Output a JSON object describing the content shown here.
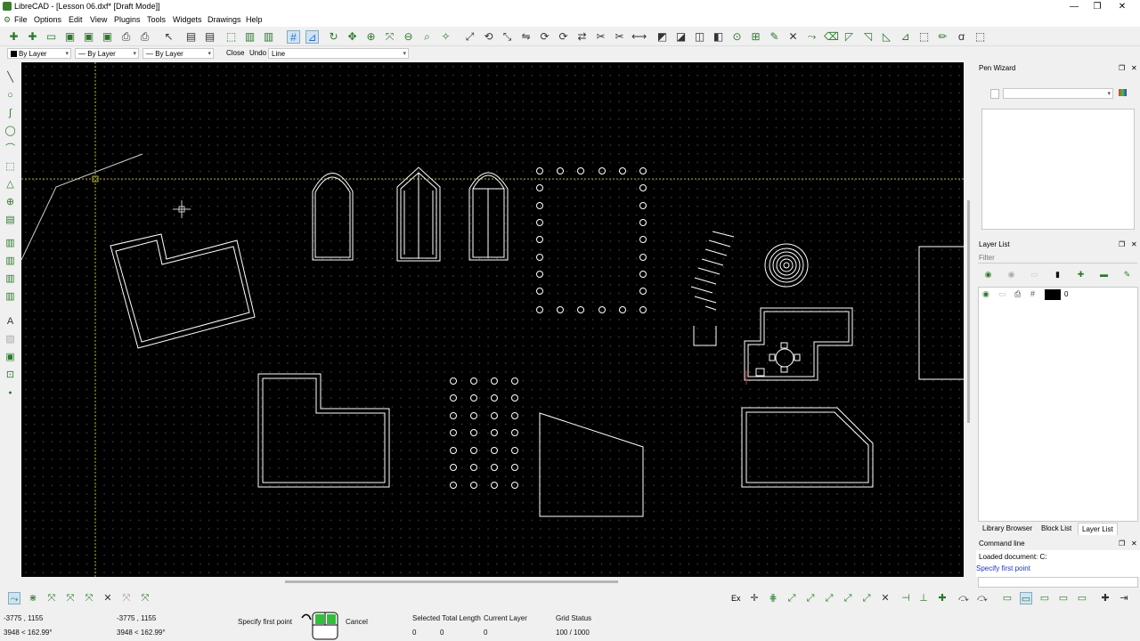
{
  "window": {
    "title": "LibreCAD - [Lesson 06.dxf* [Draft Mode]]",
    "controls": [
      "—",
      "❐",
      "✕"
    ]
  },
  "menu": [
    "File",
    "Options",
    "Edit",
    "View",
    "Plugins",
    "Tools",
    "Widgets",
    "Drawings",
    "Help"
  ],
  "properties": {
    "color": "By Layer",
    "line_type": "By Layer",
    "line_width": "By Layer",
    "close_label": "Close",
    "undo_label": "Undo",
    "line_value": "Line"
  },
  "pen_wizard": {
    "title": "Pen Wizard"
  },
  "layer_list": {
    "title": "Layer List",
    "filter_placeholder": "Filter",
    "layers": [
      {
        "name": "0"
      }
    ]
  },
  "dock_tabs": [
    "Library Browser",
    "Block List",
    "Layer List"
  ],
  "command_line": {
    "title": "Command line",
    "lines": [
      "Loaded document: C:",
      "Specify first point"
    ]
  },
  "bottom": {
    "snap_label": "Ex"
  },
  "status": {
    "abs_coord": "-3775 , 1155",
    "abs_polar": "3948 < 162.99°",
    "rel_coord": "-3775 , 1155",
    "rel_polar": "3948 < 162.99°",
    "prompt": "Specify first point",
    "cancel": "Cancel",
    "selected_total_length_label": "Selected Total Length",
    "selected_count": "0",
    "selected_length": "0",
    "current_layer_label": "Current Layer",
    "current_layer": "0",
    "grid_status_label": "Grid Status",
    "grid_status": "100 / 1000"
  },
  "colors": {
    "canvas": "#000000",
    "entity": "#ffffff",
    "crosshair": "#b5b53a",
    "accent_green": "#2a7a2a"
  }
}
